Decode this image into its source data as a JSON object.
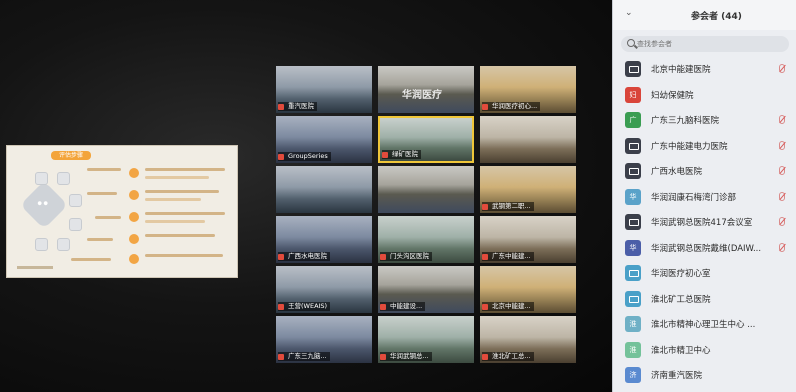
{
  "center_name": "华润医疗",
  "colors": {
    "mic_muted": "#e24b3c",
    "active_border": "#f0c73a",
    "panel_bg": "#eceef2"
  },
  "slide": {
    "title": "评估步骤",
    "center_text": "● ●"
  },
  "tiles": [
    {
      "label": "重汽医院",
      "active": false
    },
    {
      "label": "",
      "active": false
    },
    {
      "label": "华润医疗初心...",
      "active": false
    },
    {
      "label": "GroupSeries",
      "active": false
    },
    {
      "label": "绿矿医院",
      "active": true
    },
    {
      "label": "",
      "active": false
    },
    {
      "label": "",
      "active": false
    },
    {
      "label": "",
      "active": false
    },
    {
      "label": "武钢第二职...",
      "active": false
    },
    {
      "label": "广西水电医院",
      "active": false
    },
    {
      "label": "门头沟区医院",
      "active": false
    },
    {
      "label": "广东中能建...",
      "active": false
    },
    {
      "label": "王营(WEAIS)",
      "active": false
    },
    {
      "label": "中能建设...",
      "active": false
    },
    {
      "label": "北京中能建...",
      "active": false
    },
    {
      "label": "广东三九脑...",
      "active": false
    },
    {
      "label": "华润武钢总...",
      "active": false
    },
    {
      "label": "淮北矿工总...",
      "active": false
    }
  ],
  "panel": {
    "chevron": "⌄",
    "title": "参会者 (44)",
    "search_placeholder": "查找参会者",
    "participants": [
      {
        "name": "北京中能建医院",
        "icon": "monitor-icon",
        "color": "#3b3f4a",
        "muted": true
      },
      {
        "name": "妇幼保健院",
        "icon": "number-icon",
        "color": "#d9453a",
        "glyph": "妇",
        "muted": false
      },
      {
        "name": "广东三九脑科医院",
        "icon": "letter-icon",
        "color": "#3a9d52",
        "glyph": "广",
        "muted": true
      },
      {
        "name": "广东中能建电力医院",
        "icon": "monitor-icon",
        "color": "#3b3f4a",
        "muted": true
      },
      {
        "name": "广西水电医院",
        "icon": "monitor-icon",
        "color": "#3b3f4a",
        "muted": true
      },
      {
        "name": "华润润康石梅湾门诊部",
        "icon": "letter-icon",
        "color": "#5aa2c9",
        "glyph": "华",
        "muted": true
      },
      {
        "name": "华润武钢总医院417会议室",
        "icon": "monitor-icon",
        "color": "#3b3f4a",
        "muted": true
      },
      {
        "name": "华润武钢总医院戴维(DAIW...",
        "icon": "letter-icon",
        "color": "#4b5ea8",
        "glyph": "华",
        "muted": true
      },
      {
        "name": "华润医疗初心室",
        "icon": "monitor-icon",
        "color": "#4aa0c8",
        "muted": false
      },
      {
        "name": "淮北矿工总医院",
        "icon": "monitor-icon",
        "color": "#4aa0c8",
        "muted": false
      },
      {
        "name": "淮北市精神心理卫生中心 ...",
        "icon": "letter-icon",
        "color": "#6fb0c6",
        "glyph": "淮",
        "muted": false
      },
      {
        "name": "淮北市精卫中心",
        "icon": "letter-icon",
        "color": "#74c29a",
        "glyph": "淮",
        "muted": false
      },
      {
        "name": "济南重汽医院",
        "icon": "letter-icon",
        "color": "#5a8ad0",
        "glyph": "济",
        "muted": false
      }
    ]
  }
}
